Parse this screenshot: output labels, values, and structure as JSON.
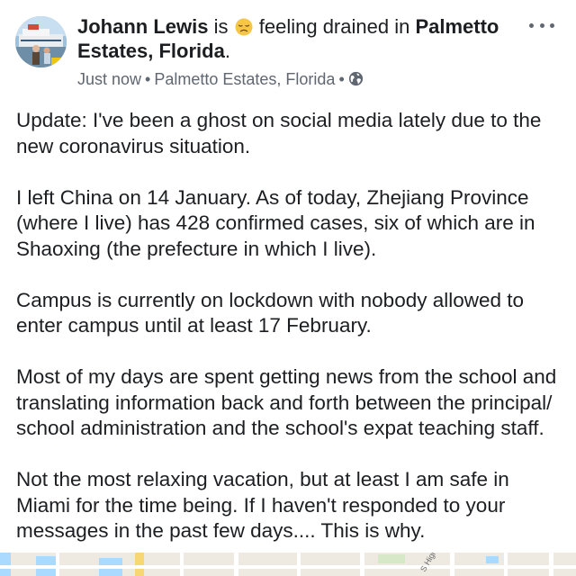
{
  "post": {
    "author": "Johann Lewis",
    "feeling_prefix": "is",
    "feeling_icon": "disappointed-face-icon",
    "feeling_text": "feeling drained in",
    "location": "Palmetto Estates, Florida",
    "headline_end": ".",
    "timestamp": "Just now",
    "meta_separator": "•",
    "meta_location": "Palmetto Estates, Florida",
    "privacy_icon": "globe-icon",
    "more_icon": "more-options-icon",
    "paragraphs": [
      "Update: I've been a ghost on social media lately due to the new coronavirus situation.",
      "I left China on 14 January. As of today, Zhejiang Province (where I live) has 428 confirmed cases, six of which are in Shaoxing (the prefecture in which I live).",
      "Campus is currently on lockdown with nobody allowed to enter campus until at least 17 February.",
      "Most of my days are spent getting news from the school and translating information back and forth between the principal/ school administration and the school's expat teaching staff.",
      "Not the most relaxing vacation, but at least I am safe in Miami for the time being. If I haven't responded to your messages in the past few days.... This is why."
    ],
    "map_street_label": "S High"
  },
  "colors": {
    "text": "#1c1e21",
    "secondary_text": "#606770",
    "map_water": "#aadaff",
    "map_road": "#ffffff",
    "map_highway": "#f7d774"
  }
}
